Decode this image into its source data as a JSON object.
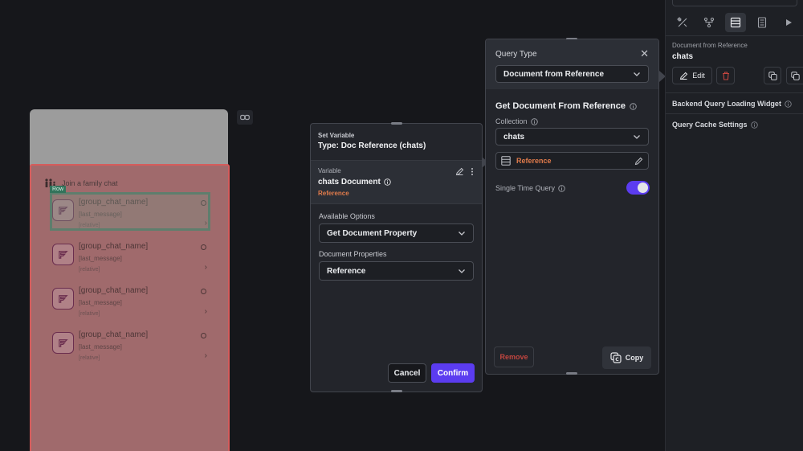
{
  "canvas": {
    "join_text": "Join a family chat",
    "row_badge": "Row",
    "list_items": [
      {
        "title": "[group_chat_name]",
        "sub": "[last_message]",
        "rel": "[relative]"
      },
      {
        "title": "[group_chat_name]",
        "sub": "[last_message]",
        "rel": "[relative]"
      },
      {
        "title": "[group_chat_name]",
        "sub": "[last_message]",
        "rel": "[relative]"
      },
      {
        "title": "[group_chat_name]",
        "sub": "[last_message]",
        "rel": "[relative]"
      }
    ]
  },
  "set_variable": {
    "heading": "Set Variable",
    "type_line": "Type: Doc Reference (chats)",
    "variable_label": "Variable",
    "variable_value": "chats Document",
    "variable_ref": "Reference",
    "available_options_label": "Available Options",
    "available_options_value": "Get Document Property",
    "document_properties_label": "Document Properties",
    "document_properties_value": "Reference",
    "cancel_label": "Cancel",
    "confirm_label": "Confirm"
  },
  "query_panel": {
    "title": "Query Type",
    "query_type_value": "Document from Reference",
    "section_title": "Get Document From Reference",
    "collection_label": "Collection",
    "collection_value": "chats",
    "reference_value": "Reference",
    "single_time_query_label": "Single Time Query",
    "single_time_query_on": true,
    "remove_label": "Remove",
    "copy_label": "Copy"
  },
  "properties": {
    "subtitle": "Document from Reference",
    "name": "chats",
    "edit_label": "Edit",
    "backend_loading_label": "Backend Query Loading Widget",
    "cache_settings_label": "Query Cache Settings"
  },
  "colors": {
    "accent": "#5b3cf0",
    "reference_orange": "#e07b4b",
    "danger": "#c2453f"
  }
}
